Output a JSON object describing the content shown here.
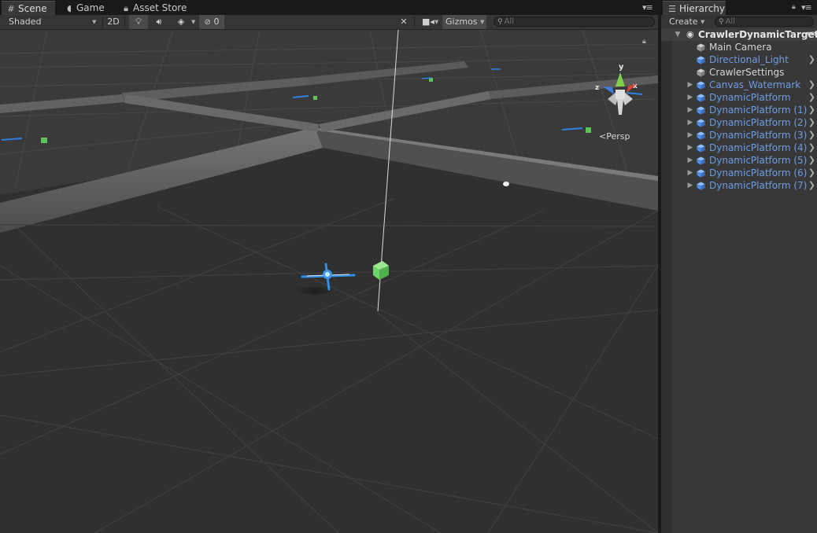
{
  "scene_panel": {
    "tabs": [
      {
        "label": "Scene",
        "icon": "grid-icon"
      },
      {
        "label": "Game",
        "icon": "pacman-icon"
      },
      {
        "label": "Asset Store",
        "icon": "lock-icon"
      }
    ],
    "toolbar": {
      "shading_mode": "Shaded",
      "mode_2d": "2D",
      "hidden_count": "0",
      "gizmos_label": "Gizmos",
      "search_placeholder": "All"
    },
    "persp_label": "Persp",
    "gizmo_axes": {
      "y": "y",
      "x": "x",
      "z": "z"
    }
  },
  "hierarchy_panel": {
    "tab_label": "Hierarchy",
    "create_label": "Create",
    "search_placeholder": "All",
    "root": "CrawlerDynamicTarget",
    "items": [
      {
        "label": "Main Camera",
        "prefab": false,
        "expandable": false
      },
      {
        "label": "Directional_Light",
        "prefab": true,
        "expandable": false
      },
      {
        "label": "CrawlerSettings",
        "prefab": false,
        "expandable": false
      },
      {
        "label": "Canvas_Watermark",
        "prefab": true,
        "expandable": true
      },
      {
        "label": "DynamicPlatform",
        "prefab": true,
        "expandable": true
      },
      {
        "label": "DynamicPlatform (1)",
        "prefab": true,
        "expandable": true
      },
      {
        "label": "DynamicPlatform (2)",
        "prefab": true,
        "expandable": true
      },
      {
        "label": "DynamicPlatform (3)",
        "prefab": true,
        "expandable": true
      },
      {
        "label": "DynamicPlatform (4)",
        "prefab": true,
        "expandable": true
      },
      {
        "label": "DynamicPlatform (5)",
        "prefab": true,
        "expandable": true
      },
      {
        "label": "DynamicPlatform (6)",
        "prefab": true,
        "expandable": true
      },
      {
        "label": "DynamicPlatform (7)",
        "prefab": true,
        "expandable": true
      }
    ]
  },
  "colors": {
    "prefab_text": "#6e9be3",
    "scene_background": "#2b2b2b",
    "gizmo_y": "#7ed04b",
    "gizmo_x": "#e0432f",
    "gizmo_z": "#3d7de0",
    "target_cube": "#6ed36a"
  }
}
